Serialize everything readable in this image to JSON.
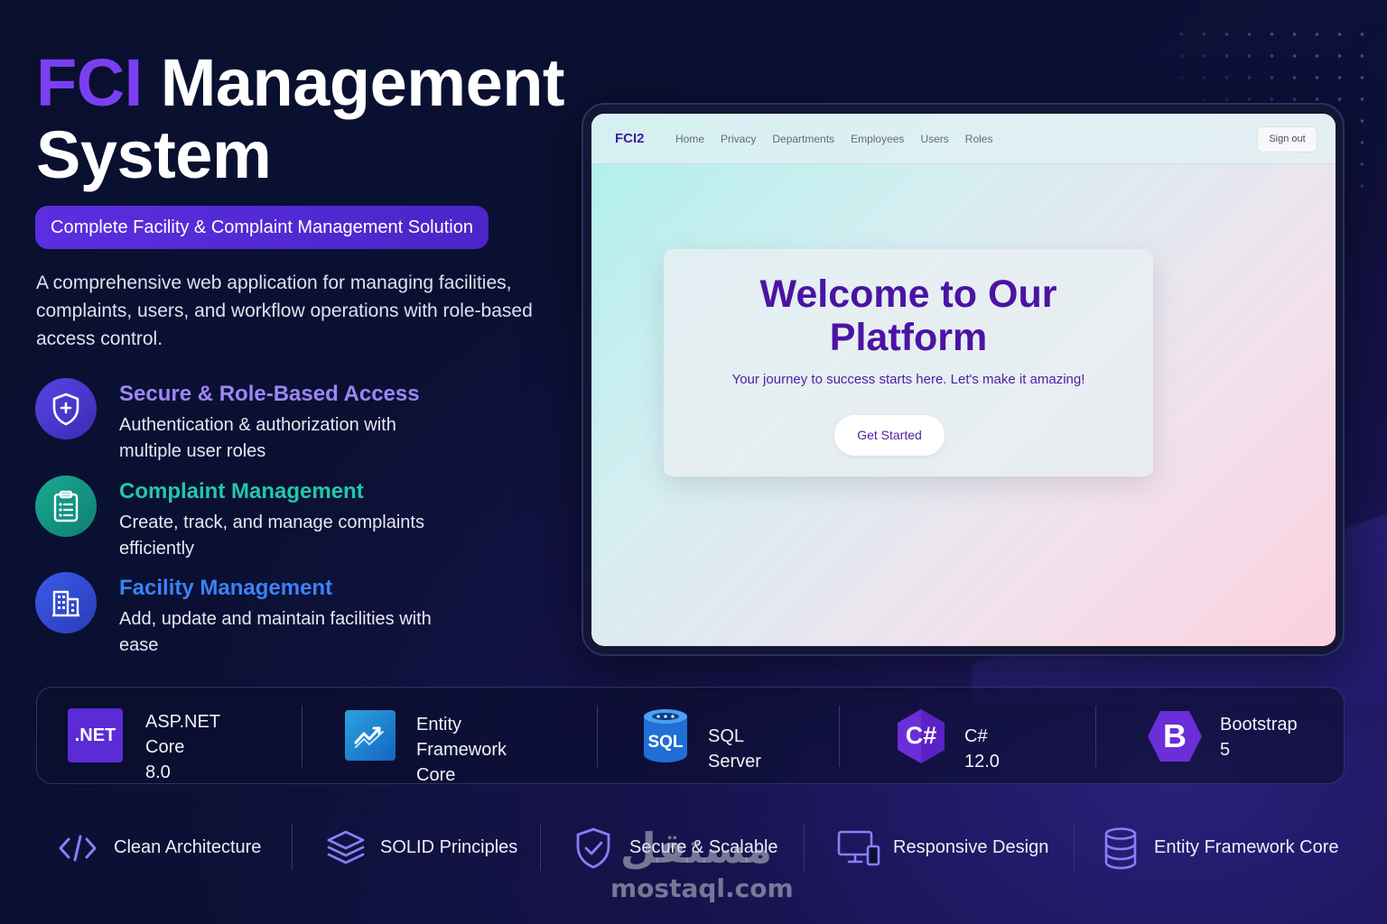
{
  "hero": {
    "title_accent": "FCI",
    "title_rest": " Management",
    "title_line2": "System",
    "subtitle": "Complete Facility & Complaint Management Solution",
    "intro": "A comprehensive web application for managing facilities, complaints, users, and workflow operations with role-based access control."
  },
  "features": [
    {
      "title": "Secure & Role-Based Access",
      "desc": "Authentication & authorization with multiple user roles",
      "icon": "shield-icon",
      "color": "#9b87f5"
    },
    {
      "title": "Complaint Management",
      "desc": "Create, track, and manage complaints efficiently",
      "icon": "clipboard-icon",
      "color": "#22c7a8"
    },
    {
      "title": "Facility Management",
      "desc": "Add, update and maintain facilities with ease",
      "icon": "building-icon",
      "color": "#3b82f6"
    }
  ],
  "mockup": {
    "brand": "FCI2",
    "nav": [
      "Home",
      "Privacy",
      "Departments",
      "Employees",
      "Users",
      "Roles"
    ],
    "sign_out": "Sign out",
    "welcome_line1": "Welcome to Our",
    "welcome_line2": "Platform",
    "tagline": "Your journey to success starts here. Let's make it amazing!",
    "cta": "Get Started"
  },
  "tech": [
    {
      "line1": "ASP.NET Core",
      "line2": "8.0",
      "badge": ".NET",
      "icon": "dotnet-icon"
    },
    {
      "line1": "Entity Framework",
      "line2": "Core",
      "icon": "entity-framework-icon"
    },
    {
      "line1": "SQL Server",
      "line2": "",
      "badge": "SQL",
      "icon": "sql-server-icon"
    },
    {
      "line1": "C# 12.0",
      "line2": "",
      "badge": "C#",
      "icon": "csharp-icon"
    },
    {
      "line1": "Bootstrap",
      "line2": "5",
      "badge": "B",
      "icon": "bootstrap-icon"
    }
  ],
  "principles": [
    {
      "label": "Clean Architecture",
      "icon": "code-icon"
    },
    {
      "label": "SOLID Principles",
      "icon": "layers-icon"
    },
    {
      "label": "Secure & Scalable",
      "icon": "shield-check-icon"
    },
    {
      "label": "Responsive Design",
      "icon": "devices-icon"
    },
    {
      "label": "Entity Framework Core",
      "icon": "database-icon"
    }
  ],
  "watermark": {
    "arabic": "مستقل",
    "domain": "mostaql.com"
  }
}
